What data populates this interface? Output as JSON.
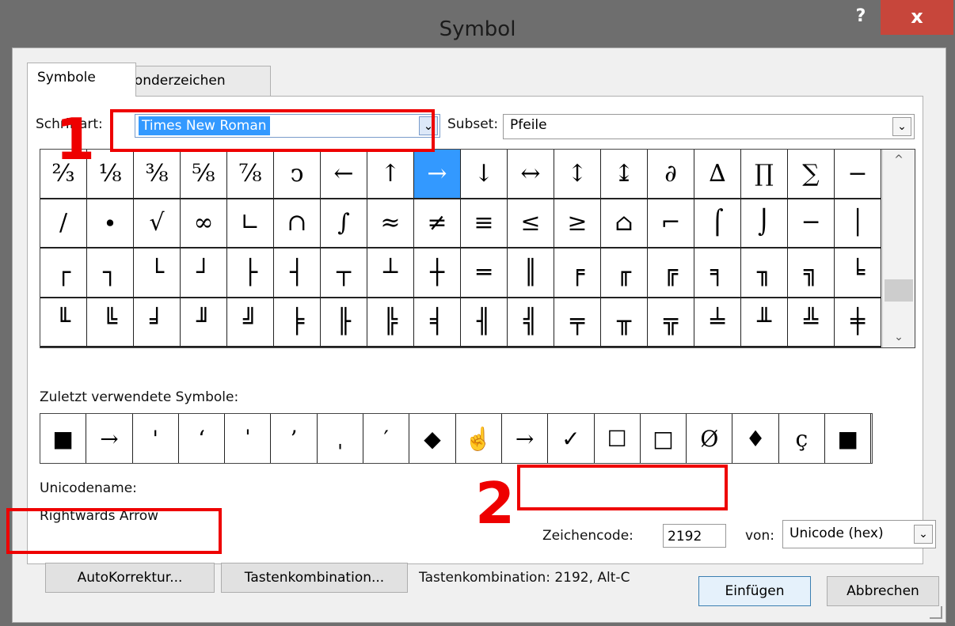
{
  "window": {
    "title": "Symbol",
    "help_label": "?",
    "close_label": "x"
  },
  "tabs": [
    {
      "label": "Symbole"
    },
    {
      "label": "Sonderzeichen"
    }
  ],
  "font": {
    "label": "Schriftart:",
    "value": "Times New Roman",
    "arrow": "⌄"
  },
  "subset": {
    "label": "Subset:",
    "value": "Pfeile",
    "arrow": "⌄"
  },
  "grid": [
    [
      "⅔",
      "⅛",
      "⅜",
      "⅝",
      "⅞",
      "ↄ",
      "←",
      "↑",
      "→",
      "↓",
      "↔",
      "↕",
      "↨",
      "∂",
      "∆",
      "∏",
      "∑",
      "−"
    ],
    [
      "∕",
      "∙",
      "√",
      "∞",
      "∟",
      "∩",
      "∫",
      "≈",
      "≠",
      "≡",
      "≤",
      "≥",
      "⌂",
      "⌐",
      "⌠",
      "⌡",
      "─",
      "│"
    ],
    [
      "┌",
      "┐",
      "└",
      "┘",
      "├",
      "┤",
      "┬",
      "┴",
      "┼",
      "═",
      "║",
      "╒",
      "╓",
      "╔",
      "╕",
      "╖",
      "╗",
      "╘"
    ],
    [
      "╙",
      "╚",
      "╛",
      "╜",
      "╝",
      "╞",
      "╟",
      "╠",
      "╡",
      "╢",
      "╣",
      "╤",
      "╥",
      "╦",
      "╧",
      "╨",
      "╩",
      "╪"
    ]
  ],
  "scroll": {
    "up": "^",
    "down": "⌄"
  },
  "recent": {
    "label": "Zuletzt verwendete Symbole:",
    "symbols": [
      "■",
      "→",
      "'",
      "‘",
      "ˈ",
      "’",
      "ˌ",
      "′",
      "◆",
      "☝",
      "→",
      "✓",
      "☐",
      "□",
      "Ø",
      "♦",
      "ç",
      "■"
    ]
  },
  "unicode": {
    "name_label": "Unicodename:",
    "name_value": "Rightwards Arrow"
  },
  "code": {
    "label": "Zeichencode:",
    "value": "2192",
    "von_label": "von:",
    "von_value": "Unicode (hex)",
    "von_arrow": "⌄"
  },
  "buttons": {
    "autokorrektur": "AutoKorrektur...",
    "tastenkombination": "Tastenkombination...",
    "insert": "Einfügen",
    "cancel": "Abbrechen"
  },
  "shortcut": {
    "text": "Tastenkombination: 2192, Alt-C"
  },
  "annotations": {
    "one": "1",
    "two": "2"
  }
}
